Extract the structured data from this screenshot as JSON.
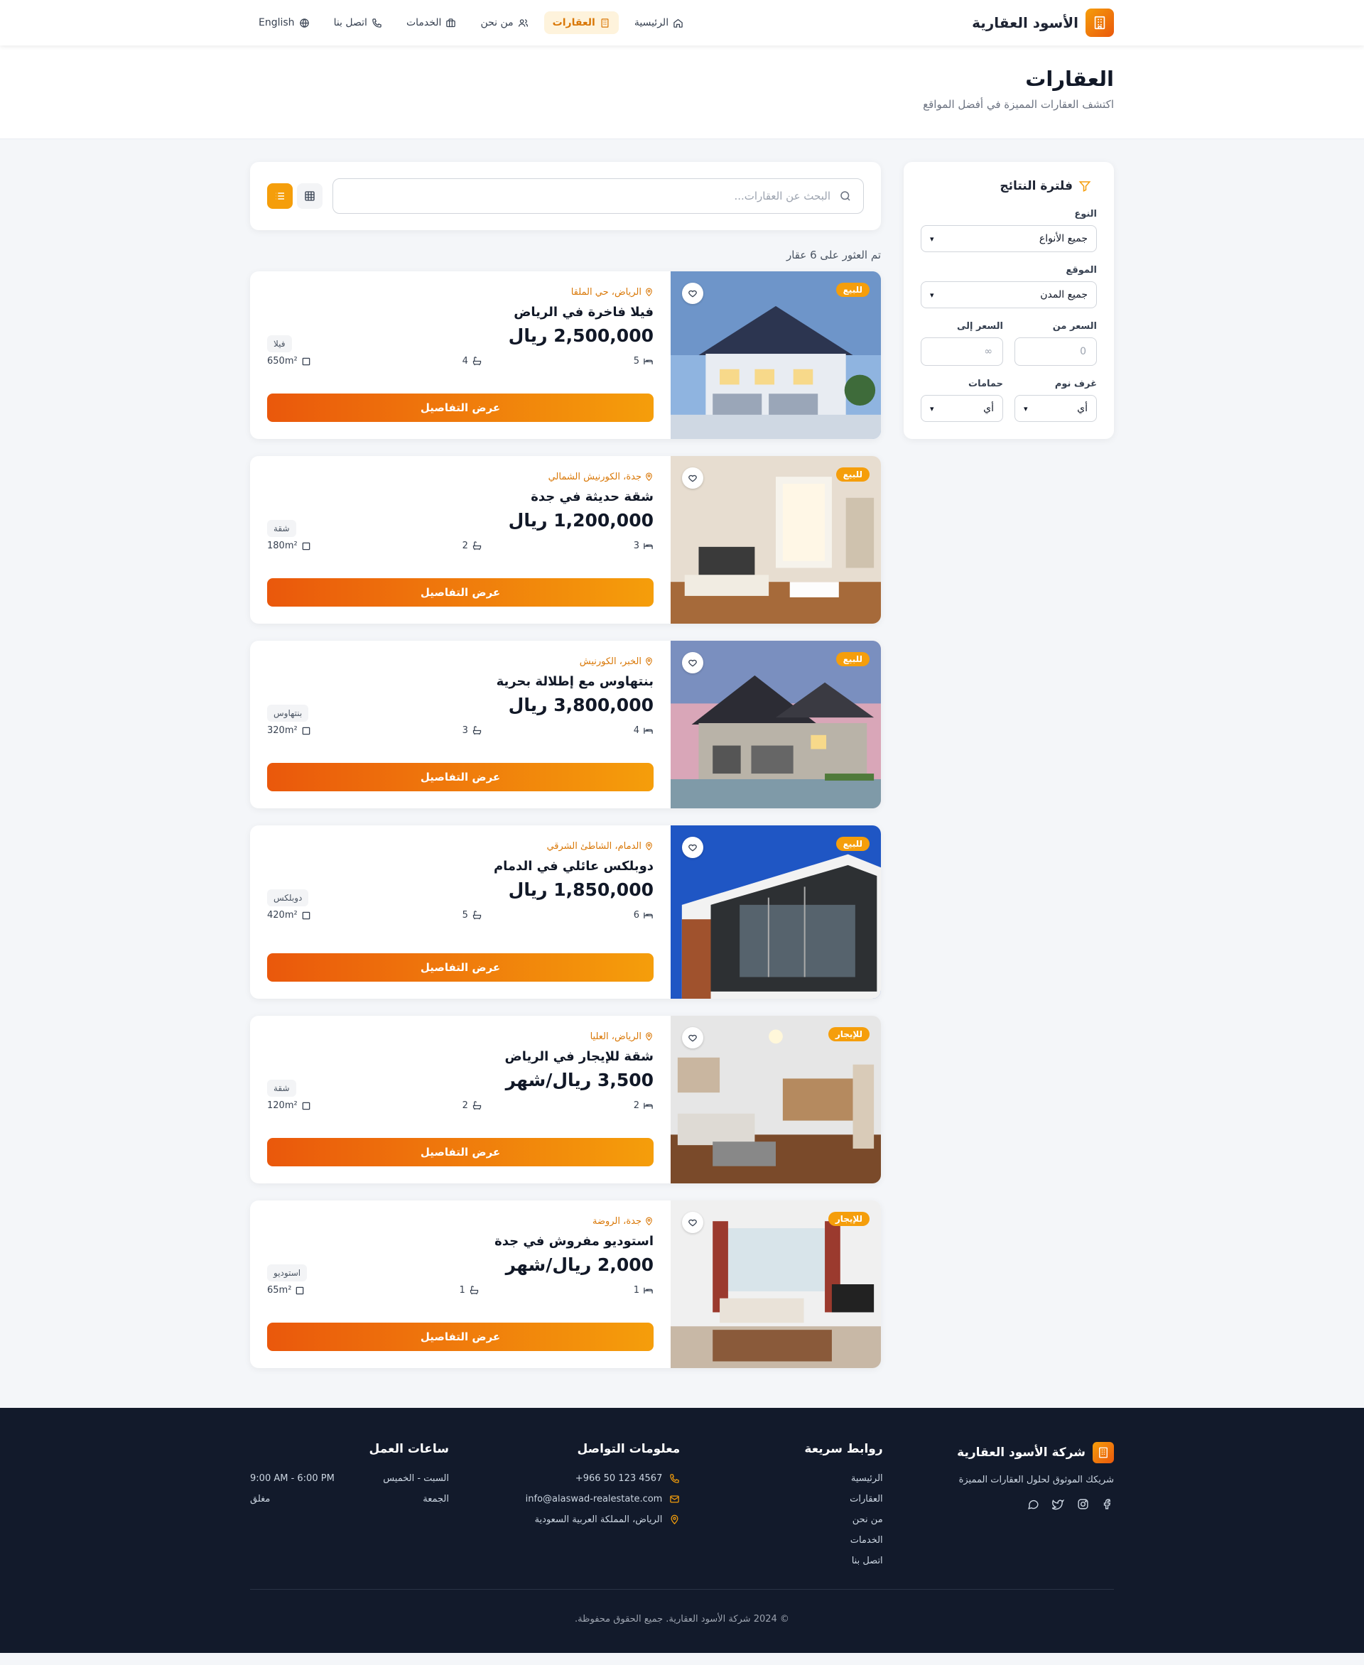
{
  "brand": {
    "name": "الأسود العقارية"
  },
  "nav": {
    "items": [
      {
        "label": "الرئيسية",
        "icon": "home-icon"
      },
      {
        "label": "العقارات",
        "icon": "building-icon",
        "active": true
      },
      {
        "label": "من نحن",
        "icon": "users-icon"
      },
      {
        "label": "الخدمات",
        "icon": "briefcase-icon"
      },
      {
        "label": "اتصل بنا",
        "icon": "phone-icon"
      },
      {
        "label": "English",
        "icon": "globe-icon"
      }
    ]
  },
  "header": {
    "title": "العقارات",
    "subtitle": "اكتشف العقارات المميزة في أفضل المواقع"
  },
  "filters": {
    "title": "فلترة النتائج",
    "type_label": "النوع",
    "type_value": "جميع الأنواع",
    "location_label": "الموقع",
    "location_value": "جميع المدن",
    "price_from_label": "السعر من",
    "price_from_placeholder": "0",
    "price_to_label": "السعر إلى",
    "price_to_placeholder": "∞",
    "bedrooms_label": "غرف نوم",
    "bedrooms_value": "أي",
    "bathrooms_label": "حمامات",
    "bathrooms_value": "أي"
  },
  "search": {
    "placeholder": "البحث عن العقارات..."
  },
  "result_count": "تم العثور على 6 عقار",
  "details_label": "عرض التفاصيل",
  "properties": [
    {
      "badge": "للبيع",
      "location": "الرياض، حي الملقا",
      "title": "فيلا فاخرة في الرياض",
      "price": "2,500,000 ريال",
      "type": "فيلا",
      "beds": "5",
      "baths": "4",
      "area": "650m²"
    },
    {
      "badge": "للبيع",
      "location": "جدة، الكورنيش الشمالي",
      "title": "شقة حديثة في جدة",
      "price": "1,200,000 ريال",
      "type": "شقة",
      "beds": "3",
      "baths": "2",
      "area": "180m²"
    },
    {
      "badge": "للبيع",
      "location": "الخبر، الكورنيش",
      "title": "بنتهاوس مع إطلالة بحرية",
      "price": "3,800,000 ريال",
      "type": "بنتهاوس",
      "beds": "4",
      "baths": "3",
      "area": "320m²"
    },
    {
      "badge": "للبيع",
      "location": "الدمام، الشاطئ الشرقي",
      "title": "دوبلكس عائلي في الدمام",
      "price": "1,850,000 ريال",
      "type": "دوبلكس",
      "beds": "6",
      "baths": "5",
      "area": "420m²"
    },
    {
      "badge": "للإيجار",
      "location": "الرياض، العليا",
      "title": "شقة للإيجار في الرياض",
      "price": "3,500 ريال/شهر",
      "type": "شقة",
      "beds": "2",
      "baths": "2",
      "area": "120m²"
    },
    {
      "badge": "للإيجار",
      "location": "جدة، الروضة",
      "title": "استوديو مفروش في جدة",
      "price": "2,000 ريال/شهر",
      "type": "استوديو",
      "beds": "1",
      "baths": "1",
      "area": "65m²"
    }
  ],
  "footer": {
    "brand": "شركة الأسود العقارية",
    "tagline": "شريكك الموثوق لحلول العقارات المميزة",
    "quick_links_title": "روابط سريعة",
    "quick_links": [
      "الرئيسية",
      "العقارات",
      "من نحن",
      "الخدمات",
      "اتصل بنا"
    ],
    "contact_title": "معلومات التواصل",
    "phone": "+966 50 123 4567",
    "email": "info@alaswad-realestate.com",
    "address": "الرياض، المملكة العربية السعودية",
    "hours_title": "ساعات العمل",
    "hours_days_1": "السبت - الخميس",
    "hours_time_1": "9:00 AM - 6:00 PM",
    "hours_days_2": "الجمعة",
    "hours_time_2": "مغلق",
    "copyright": "© 2024 شركة الأسود العقارية. جميع الحقوق محفوظة."
  },
  "colors": {
    "accent": "#f59e0b",
    "accent_dark": "#ea580c",
    "footer_bg": "#121a2b"
  }
}
